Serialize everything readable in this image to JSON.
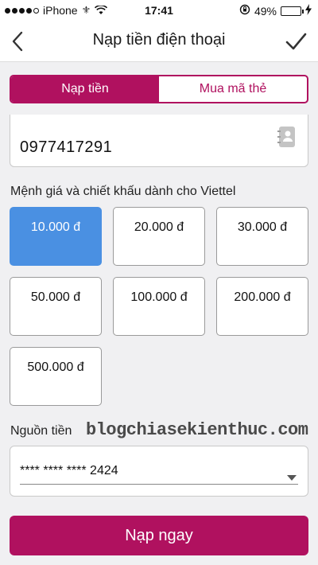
{
  "status_bar": {
    "carrier": "iPhone",
    "time": "17:41",
    "battery_percent": "49%",
    "battery_level": 0.49
  },
  "nav": {
    "title": "Nạp tiền điện thoại",
    "back_icon": "chevron-left-icon",
    "confirm_icon": "checkmark-icon"
  },
  "tabs": [
    {
      "label": "Nạp tiền",
      "active": true
    },
    {
      "label": "Mua mã thẻ",
      "active": false
    }
  ],
  "phone": {
    "value": "0977417291",
    "icon": "contact-book-icon"
  },
  "denomination_label": "Mệnh giá và chiết khấu dành cho Viettel",
  "amounts": [
    {
      "label": "10.000 đ",
      "selected": true
    },
    {
      "label": "20.000 đ",
      "selected": false
    },
    {
      "label": "30.000 đ",
      "selected": false
    },
    {
      "label": "50.000 đ",
      "selected": false
    },
    {
      "label": "100.000 đ",
      "selected": false
    },
    {
      "label": "200.000 đ",
      "selected": false
    },
    {
      "label": "500.000 đ",
      "selected": false
    }
  ],
  "source": {
    "label": "Nguồn tiền",
    "card_value": "**** **** **** 2424"
  },
  "watermark": "blogchiasekienthuc.com",
  "submit_label": "Nạp ngay",
  "colors": {
    "brand": "#b0115f",
    "selected": "#4a90e2"
  }
}
